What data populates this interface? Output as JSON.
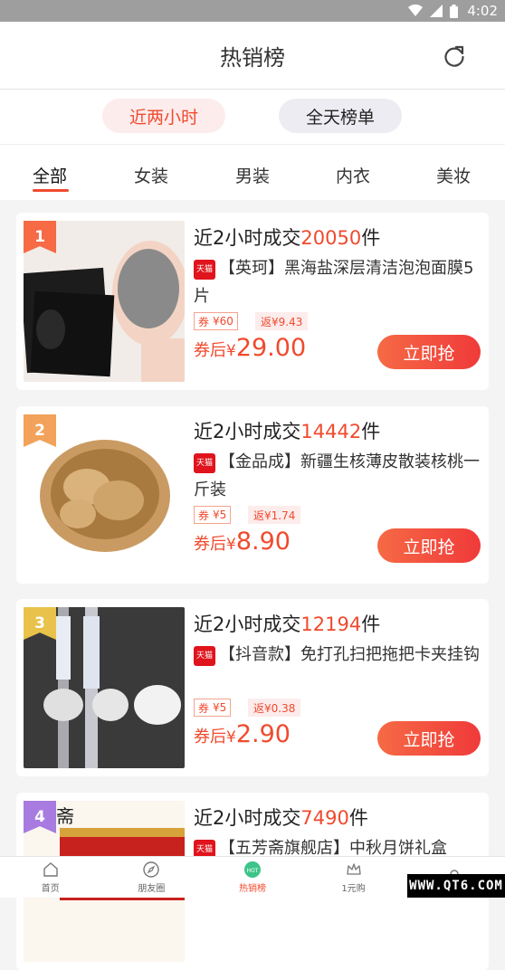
{
  "status_bar": {
    "time": "4:02"
  },
  "header": {
    "title": "热销榜"
  },
  "toggles": {
    "active": "近两小时",
    "inactive": "全天榜单"
  },
  "categories": [
    "全部",
    "女装",
    "男装",
    "内衣",
    "美妆"
  ],
  "products": [
    {
      "rank": "1",
      "rank_color": "#f66a45",
      "prefix": "近2小时成交",
      "count": "20050",
      "suffix": "件",
      "tmall": "天猫",
      "desc": "【英珂】黑海盐深层清洁泡泡面膜5片",
      "coupon_label": "券",
      "coupon": "¥60",
      "rebate": "返¥9.43",
      "price_label": "券后",
      "yen": "¥",
      "price": "29.00",
      "buy": "立即抢"
    },
    {
      "rank": "2",
      "rank_color": "#f2a25a",
      "prefix": "近2小时成交",
      "count": "14442",
      "suffix": "件",
      "tmall": "天猫",
      "desc": "【金品成】新疆生核薄皮散装核桃一斤装",
      "coupon_label": "券",
      "coupon": "¥5",
      "rebate": "返¥1.74",
      "price_label": "券后",
      "yen": "¥",
      "price": "8.90",
      "buy": "立即抢"
    },
    {
      "rank": "3",
      "rank_color": "#e8c24a",
      "prefix": "近2小时成交",
      "count": "12194",
      "suffix": "件",
      "tmall": "天猫",
      "desc": "【抖音款】免打孔扫把拖把卡夹挂钩",
      "coupon_label": "券",
      "coupon": "¥5",
      "rebate": "返¥0.38",
      "price_label": "券后",
      "yen": "¥",
      "price": "2.90",
      "buy": "立即抢"
    },
    {
      "rank": "4",
      "rank_color": "#a77be0",
      "prefix": "近2小时成交",
      "count": "7490",
      "suffix": "件",
      "tmall": "天猫",
      "desc": "【五芳斋旗舰店】中秋月饼礼盒",
      "coupon_label": "",
      "coupon": "",
      "rebate": "",
      "price_label": "",
      "yen": "",
      "price": "",
      "buy": ""
    }
  ],
  "tabbar": [
    {
      "label": "首页",
      "icon": "home-icon"
    },
    {
      "label": "朋友圈",
      "icon": "compass-icon"
    },
    {
      "label": "热销榜",
      "icon": "hot-icon",
      "badge": "HOT"
    },
    {
      "label": "1元购",
      "icon": "crown-icon"
    },
    {
      "label": "",
      "icon": "user-icon"
    }
  ],
  "watermark": "WWW.QT6.COM"
}
